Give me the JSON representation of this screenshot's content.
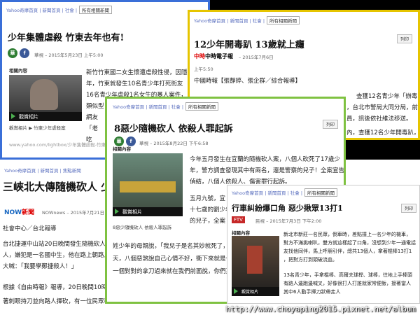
{
  "card1": {
    "breadcrumb": "Yahoo奇摩首頁 | 新聞首頁 | 社會 |",
    "select": "所有相關新聞",
    "title": "少年集體虐殺 竹東去年也有!",
    "source": "華視",
    "date": "– 2015年5月23日 上午5:00",
    "print": "列印",
    "related": "相關內容",
    "video_label": "觀賞相片",
    "caption": "相關內容:竹東少年集體虐殺",
    "url": "www.yahoo.com/lightbox/少年集體虐殺-竹東去年也有-photo",
    "lines": [
      "新竹竹東國二女生懷遭虐殺性侵，因隱",
      "年，竹東就發生10名青少年打死街友",
      "16名青少年虐殺1名女生的暴人案件，",
      "類似型",
      "網友",
      "「老",
      "吃"
    ],
    "caption_under": "觀賞相片 ▶ 竹東少年虐殺案"
  },
  "card2": {
    "breadcrumb": "Yahoo奇摩首頁 | 新聞首頁 | 社會 |",
    "select": "所有相關新聞",
    "title": "12少年開毒趴 13歲就上癮",
    "media": "中時電子報",
    "date": "– 2015年7月6日",
    "time": "上午5:50",
    "print": "列印",
    "byline": "中國時報【張靜婷、張企群／綜合報導】",
    "right_lines": [
      "查獲12名青少年「辦毒",
      "，台北市警局大同分局，前",
      "員，訊後依社維法移送。",
      "內，查獲12名少年開毒趴，"
    ]
  },
  "card3": {
    "breadcrumb": "Yahoo奇摩首頁 | 新聞首頁 | 社會 |",
    "select": "所有相關新聞",
    "title": "8惡少隨機砍人 依殺人罪起訴",
    "source": "華視",
    "date": "– 2015年8月22日 下午6:58",
    "print": "列印",
    "related": "相關內容",
    "video_label": "觀賞相片",
    "caption": "8惡少隨機砍人 依殺人罪起訴",
    "lines": [
      "今年五月發生在宜蘭的隨機砍人案，八個人砍死了17歲少",
      "年，警方調查發現其中有兩名，還是警察的兒子！全案宣告",
      "偵結，八個人依殺人、傷害罪行起訴。",
      "",
      "五月九號，宜",
      "十七歲的劉少年被",
      "的兒子，全案",
      "",
      "姓少年的母親說，「我兒子是名其妙就死了，",
      "天，八個惡煞說自己心情不好，衝下來就是一",
      "一個對對的拿刀過來就在我們前面說，你們真"
    ]
  },
  "card4": {
    "breadcrumb": "Yahoo奇摩首頁 | 新聞首頁 | 焦點新聞",
    "title": "三峽北大傳隨機砍人 少年持",
    "media": "NOWnews",
    "date": "– 2015年7月21日 上午8:40",
    "dept": "社會中心／台北報導",
    "lines": [
      "台北捷運中山站20日晚間發生隨機砍人案，",
      "人，嫌犯是一名國中生，他在路上朝路人揮刀",
      "大喊：「我要學鄭捷殺人！」",
      "",
      "根據《自由時報》報導，20日晚間10時許，新北市三峽區台北大學附近，一名男國中生拿",
      "著刺眼持刀並向路人揮砍，有一位民眾報警過程時，遭三路路某士，受盡那件事，但是北"
    ]
  },
  "card5": {
    "breadcrumb": "Yahoo奇摩首頁 | 新聞首頁 | 社會 |",
    "select": "所有相關新聞",
    "title": "行車糾紛爆口角 惡少揪眾13打1",
    "media": "民視",
    "date": "– 2015年7月3日 下午2:00",
    "print": "列印",
    "related": "相關內容",
    "video_label": "觀賞相片",
    "lines": [
      "新北市新莊一名民眾，倒車時，差點撞上一名少年的機車，",
      "對方不滿挑喇叭，雙方就這樣起了口角，沒想到少年一通電話",
      "友找他同伴，馬上呼朋引伴，總共13個人，拿著棍棒13打1",
      "，把對方打到頭破流血。",
      "",
      "13名青少年，手拿棍棒、高爾夫球桿、球棒，往地上手棒頭",
      "有路人邊跑邊喊叉，好像很打人打誰就家常便飯，接著當人",
      "其中6人動手揮刀狀帶走人"
    ]
  },
  "watermark": "http://www.choyaping2015.pixnet.net/album",
  "colors": {
    "background": "#000000",
    "card1_border": "#3a6fd8",
    "card2_border": "#e6c500",
    "card3_border": "#7fc241",
    "card4_border": "#ffffff",
    "accent_link": "#5a6fbf"
  }
}
